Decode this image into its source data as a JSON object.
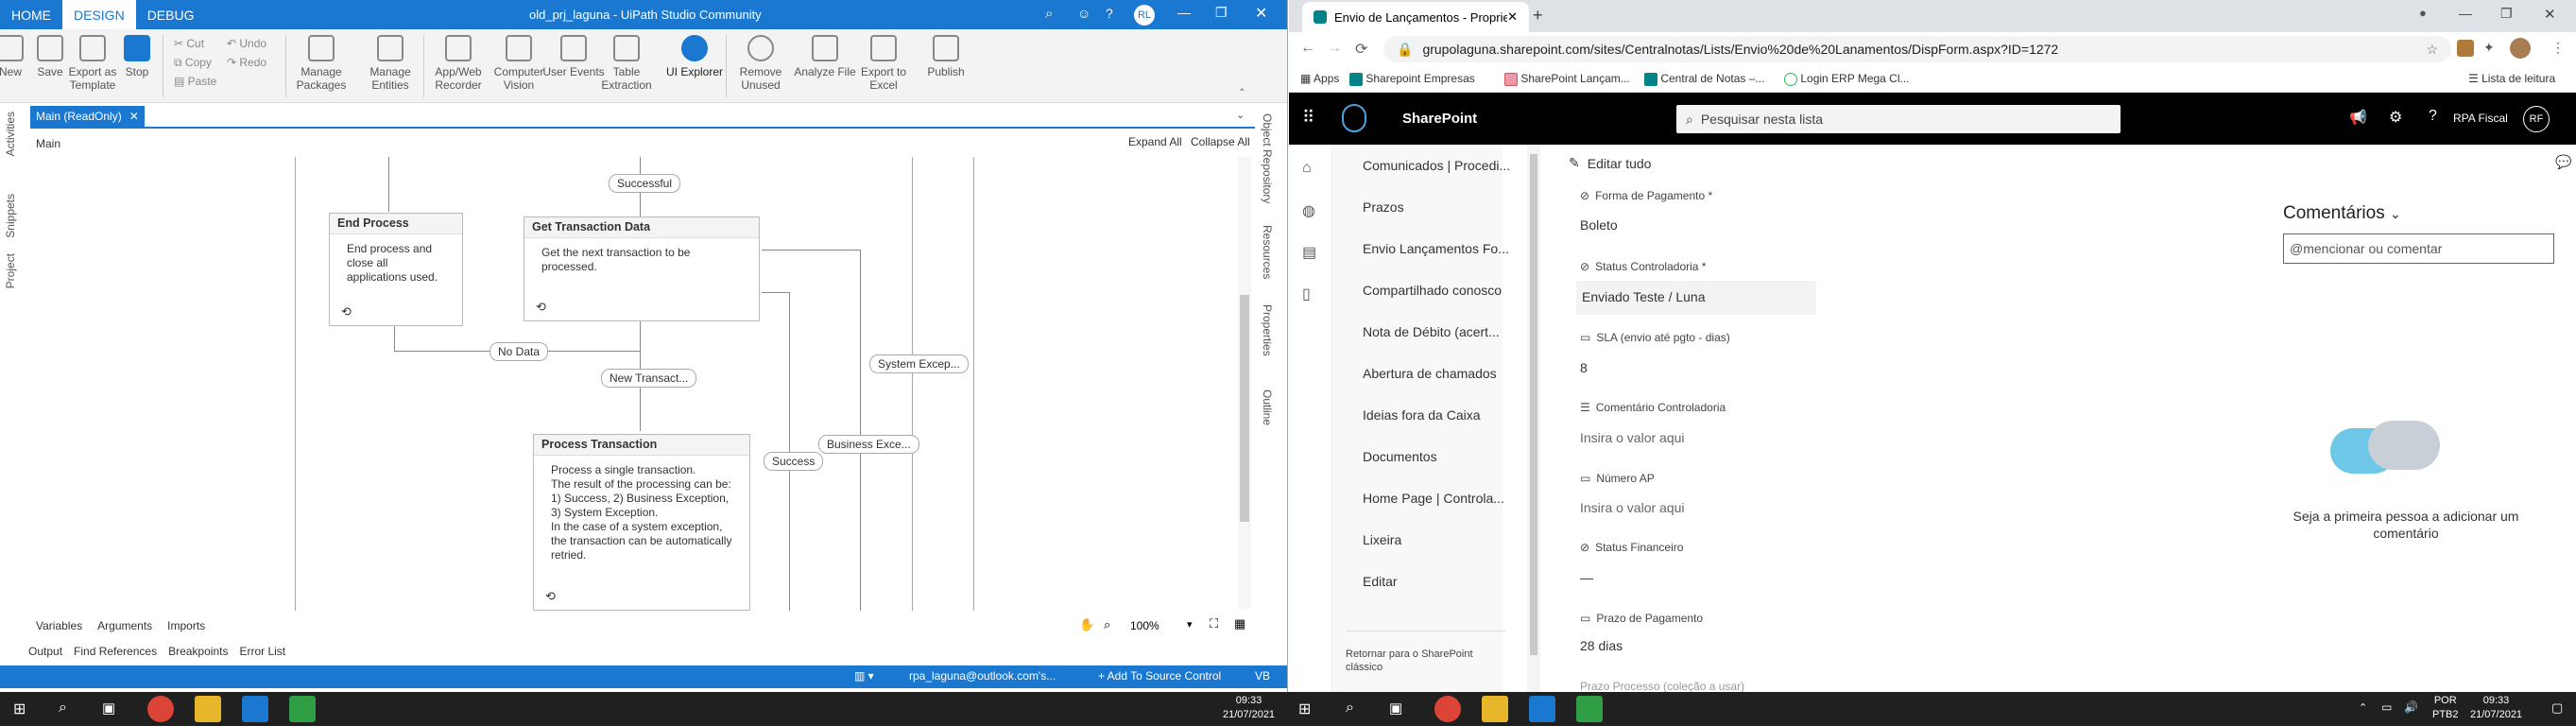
{
  "uipath": {
    "title": "old_prj_laguna - UiPath Studio Community",
    "tabs": [
      "HOME",
      "DESIGN",
      "DEBUG"
    ],
    "user_initials": "RL",
    "ribbon": {
      "new": "New",
      "save": "Save",
      "export_template": "Export as Template",
      "stop": "Stop",
      "cut": "Cut",
      "copy": "Copy",
      "paste": "Paste",
      "undo": "Undo",
      "redo": "Redo",
      "manage_packages": "Manage Packages",
      "manage_entities": "Manage Entities",
      "app_web_recorder": "App/Web Recorder",
      "computer_vision": "Computer Vision",
      "user_events": "User Events",
      "table_extraction": "Table Extraction",
      "ui_explorer": "UI Explorer",
      "remove_unused": "Remove Unused",
      "analyze_file": "Analyze File",
      "export_excel": "Export to Excel",
      "publish": "Publish"
    },
    "side_panels_left": [
      "Activities",
      "Snippets",
      "Project"
    ],
    "side_panels_right": [
      "Object Repository",
      "Resources",
      "Properties",
      "Outline"
    ],
    "doc_tab": "Main (ReadOnly)",
    "breadcrumb": "Main",
    "expand_all": "Expand All",
    "collapse_all": "Collapse All",
    "activities": {
      "end_process": {
        "title": "End Process",
        "body": "End process and close all applications used."
      },
      "get_transaction": {
        "title": "Get Transaction Data",
        "body": "Get the next transaction to be processed."
      },
      "process_transaction": {
        "title": "Process Transaction",
        "body": "Process a single transaction.\nThe result of the processing can be: 1) Success, 2) Business Exception, 3) System Exception.\nIn the case of a system exception, the transaction can be automatically retried."
      }
    },
    "flow_labels": {
      "successful": "Successful",
      "no_data": "No Data",
      "new_transaction": "New Transact...",
      "system_exception": "System Excep...",
      "business_exception": "Business Exce...",
      "success": "Success"
    },
    "bottom_tabs": [
      "Variables",
      "Arguments",
      "Imports"
    ],
    "zoom": "100%",
    "output_tabs": [
      "Output",
      "Find References",
      "Breakpoints",
      "Error List"
    ],
    "status": {
      "account": "rpa_laguna@outlook.com's...",
      "source_control": "+ Add To Source Control",
      "lang": "VB"
    }
  },
  "chrome": {
    "tab_title": "Envio de Lançamentos - Proprie",
    "url": "grupolaguna.sharepoint.com/sites/Centralnotas/Lists/Envio%20de%20Lanamentos/DispForm.aspx?ID=1272",
    "bookmarks": [
      "Apps",
      "Sharepoint Empresas",
      "SharePoint Lançam...",
      "Central de Notas –...",
      "Login ERP Mega Cl..."
    ],
    "reading_list": "Lista de leitura"
  },
  "sharepoint": {
    "brand": "SharePoint",
    "search_placeholder": "Pesquisar nesta lista",
    "user_name": "RPA Fiscal",
    "user_initials": "RF",
    "nav": [
      "Comunicados | Procedi...",
      "Prazos",
      "Envio Lançamentos Fo...",
      "Compartilhado conosco",
      "Nota de Débito (acert...",
      "Abertura de chamados",
      "Ideias fora da Caixa",
      "Documentos",
      "Home Page | Controla...",
      "Lixeira",
      "Editar"
    ],
    "return_classic": "Retornar para o SharePoint clássico",
    "edit_all": "Editar tudo",
    "fields": [
      {
        "label": "Forma de Pagamento *",
        "value": "Boleto",
        "ph": false
      },
      {
        "label": "Status Controladoria *",
        "value": "Enviado Teste / Luna",
        "ph": false
      },
      {
        "label": "SLA (envio até pgto - dias)",
        "value": "8",
        "ph": false
      },
      {
        "label": "Comentário Controladoria",
        "value": "Insira o valor aqui",
        "ph": true
      },
      {
        "label": "Número AP",
        "value": "Insira o valor aqui",
        "ph": true
      },
      {
        "label": "Status Financeiro",
        "value": "—",
        "ph": false
      },
      {
        "label": "Prazo de Pagamento",
        "value": "28 dias",
        "ph": false
      },
      {
        "label": "Prazo Processo (coleção a usar)",
        "value": "",
        "ph": false
      }
    ],
    "comments_title": "Comentários",
    "comment_placeholder": "@mencionar ou comentar",
    "first_comment": "Seja a primeira pessoa a adicionar um comentário"
  },
  "taskbar": {
    "time_left": "09:33",
    "date_left": "21/07/2021",
    "lang": "POR",
    "kbd": "PTB2",
    "time_right": "09:33",
    "date_right": "21/07/2021"
  }
}
